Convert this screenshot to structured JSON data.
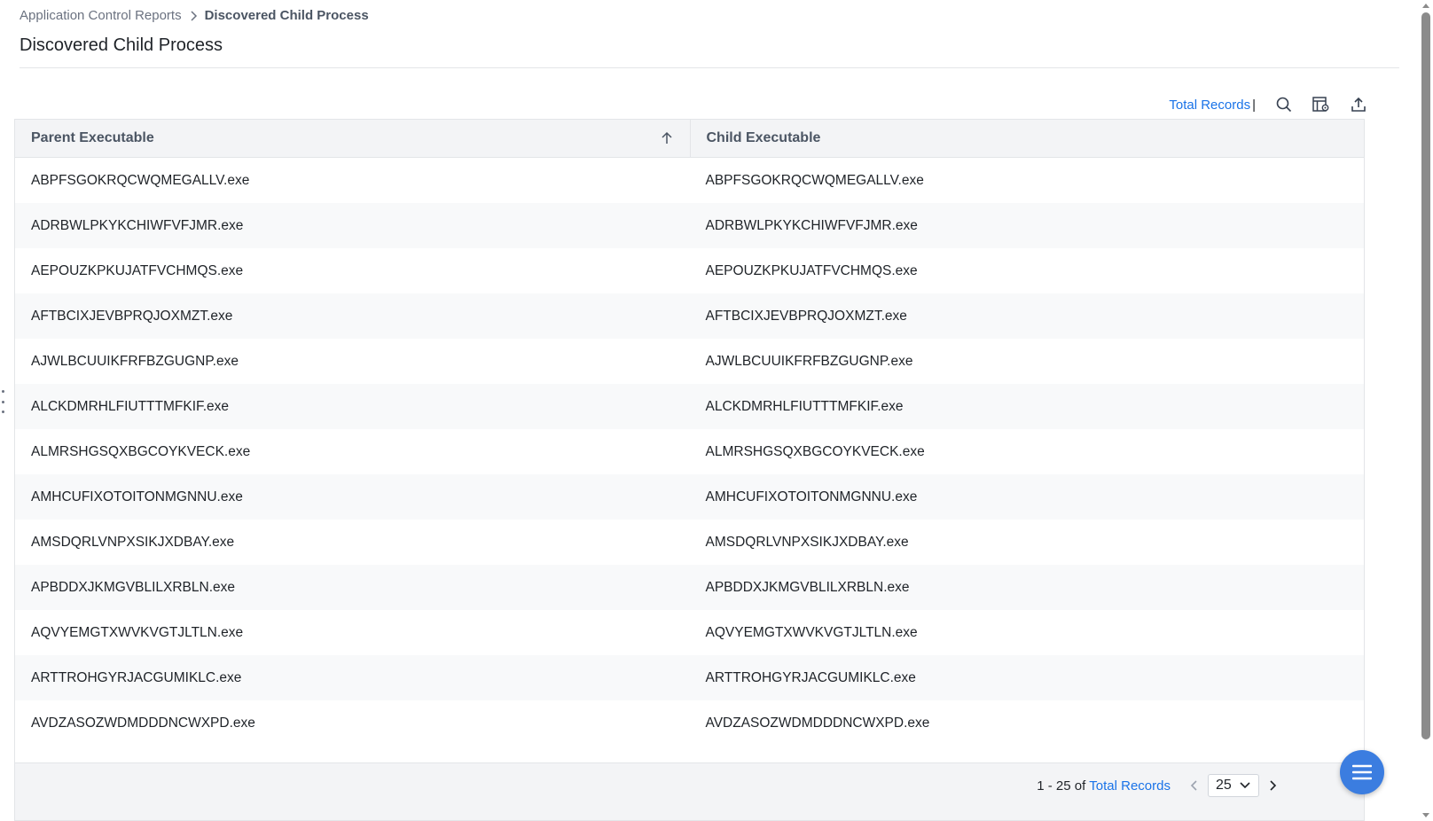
{
  "breadcrumb": {
    "parent": "Application Control Reports",
    "current": "Discovered Child Process"
  },
  "page": {
    "title": "Discovered Child Process"
  },
  "toolbar": {
    "total_records_label": "Total Records",
    "separator": "|",
    "icons": [
      "search-icon",
      "column-settings-icon",
      "export-icon"
    ]
  },
  "table": {
    "columns": [
      {
        "label": "Parent Executable",
        "sort": "ascending"
      },
      {
        "label": "Child Executable"
      }
    ],
    "rows": [
      [
        "ABPFSGOKRQCWQMEGALLV.exe",
        "ABPFSGOKRQCWQMEGALLV.exe"
      ],
      [
        "ADRBWLPKYKCHIWFVFJMR.exe",
        "ADRBWLPKYKCHIWFVFJMR.exe"
      ],
      [
        "AEPOUZKPKUJATFVCHMQS.exe",
        "AEPOUZKPKUJATFVCHMQS.exe"
      ],
      [
        "AFTBCIXJEVBPRQJOXMZT.exe",
        "AFTBCIXJEVBPRQJOXMZT.exe"
      ],
      [
        "AJWLBCUUIKFRFBZGUGNP.exe",
        "AJWLBCUUIKFRFBZGUGNP.exe"
      ],
      [
        "ALCKDMRHLFIUTTTMFKIF.exe",
        "ALCKDMRHLFIUTTTMFKIF.exe"
      ],
      [
        "ALMRSHGSQXBGCOYKVECK.exe",
        "ALMRSHGSQXBGCOYKVECK.exe"
      ],
      [
        "AMHCUFIXOTOITONMGNNU.exe",
        "AMHCUFIXOTOITONMGNNU.exe"
      ],
      [
        "AMSDQRLVNPXSIKJXDBAY.exe",
        "AMSDQRLVNPXSIKJXDBAY.exe"
      ],
      [
        "APBDDXJKMGVBLILXRBLN.exe",
        "APBDDXJKMGVBLILXRBLN.exe"
      ],
      [
        "AQVYEMGTXWVKVGTJLTLN.exe",
        "AQVYEMGTXWVKVGTJLTLN.exe"
      ],
      [
        "ARTTROHGYRJACGUMIKLC.exe",
        "ARTTROHGYRJACGUMIKLC.exe"
      ],
      [
        "AVDZASOZWDMDDDNCWXPD.exe",
        "AVDZASOZWDMDDDNCWXPD.exe"
      ]
    ]
  },
  "pagination": {
    "range": "1 - 25 of",
    "total_label": "Total Records",
    "page_size": "25"
  },
  "colors": {
    "link": "#1a73e8",
    "header_bg": "#f3f4f6",
    "fab": "#3b7de0"
  }
}
